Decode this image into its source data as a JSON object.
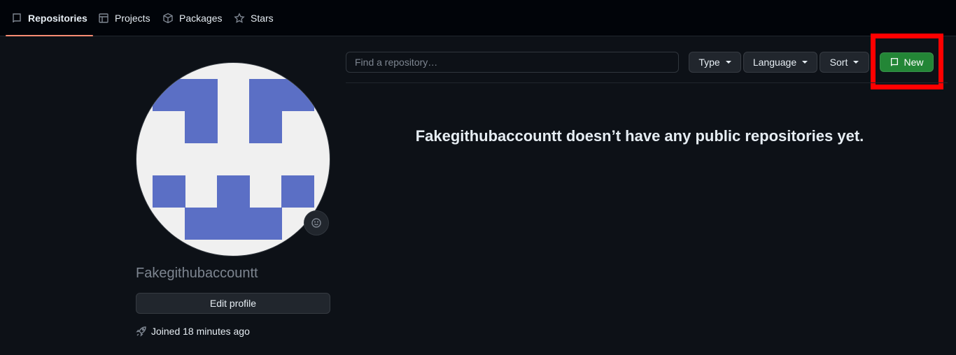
{
  "nav": {
    "tabs": [
      {
        "label": "Repositories",
        "icon": "repo-icon",
        "active": true
      },
      {
        "label": "Projects",
        "icon": "table-icon",
        "active": false
      },
      {
        "label": "Packages",
        "icon": "package-icon",
        "active": false
      },
      {
        "label": "Stars",
        "icon": "star-icon",
        "active": false
      }
    ]
  },
  "profile": {
    "username": "Fakegithubaccountt",
    "edit_label": "Edit profile",
    "joined": "Joined 18 minutes ago",
    "avatar_color": "#5b6fc5"
  },
  "repos": {
    "search_placeholder": "Find a repository…",
    "type_label": "Type",
    "language_label": "Language",
    "sort_label": "Sort",
    "new_label": "New",
    "empty_message": "Fakegithubaccountt doesn’t have any public repositories yet."
  },
  "colors": {
    "accent_tab": "#fd8c73",
    "new_button": "#238636",
    "highlight": "#ff0000"
  }
}
